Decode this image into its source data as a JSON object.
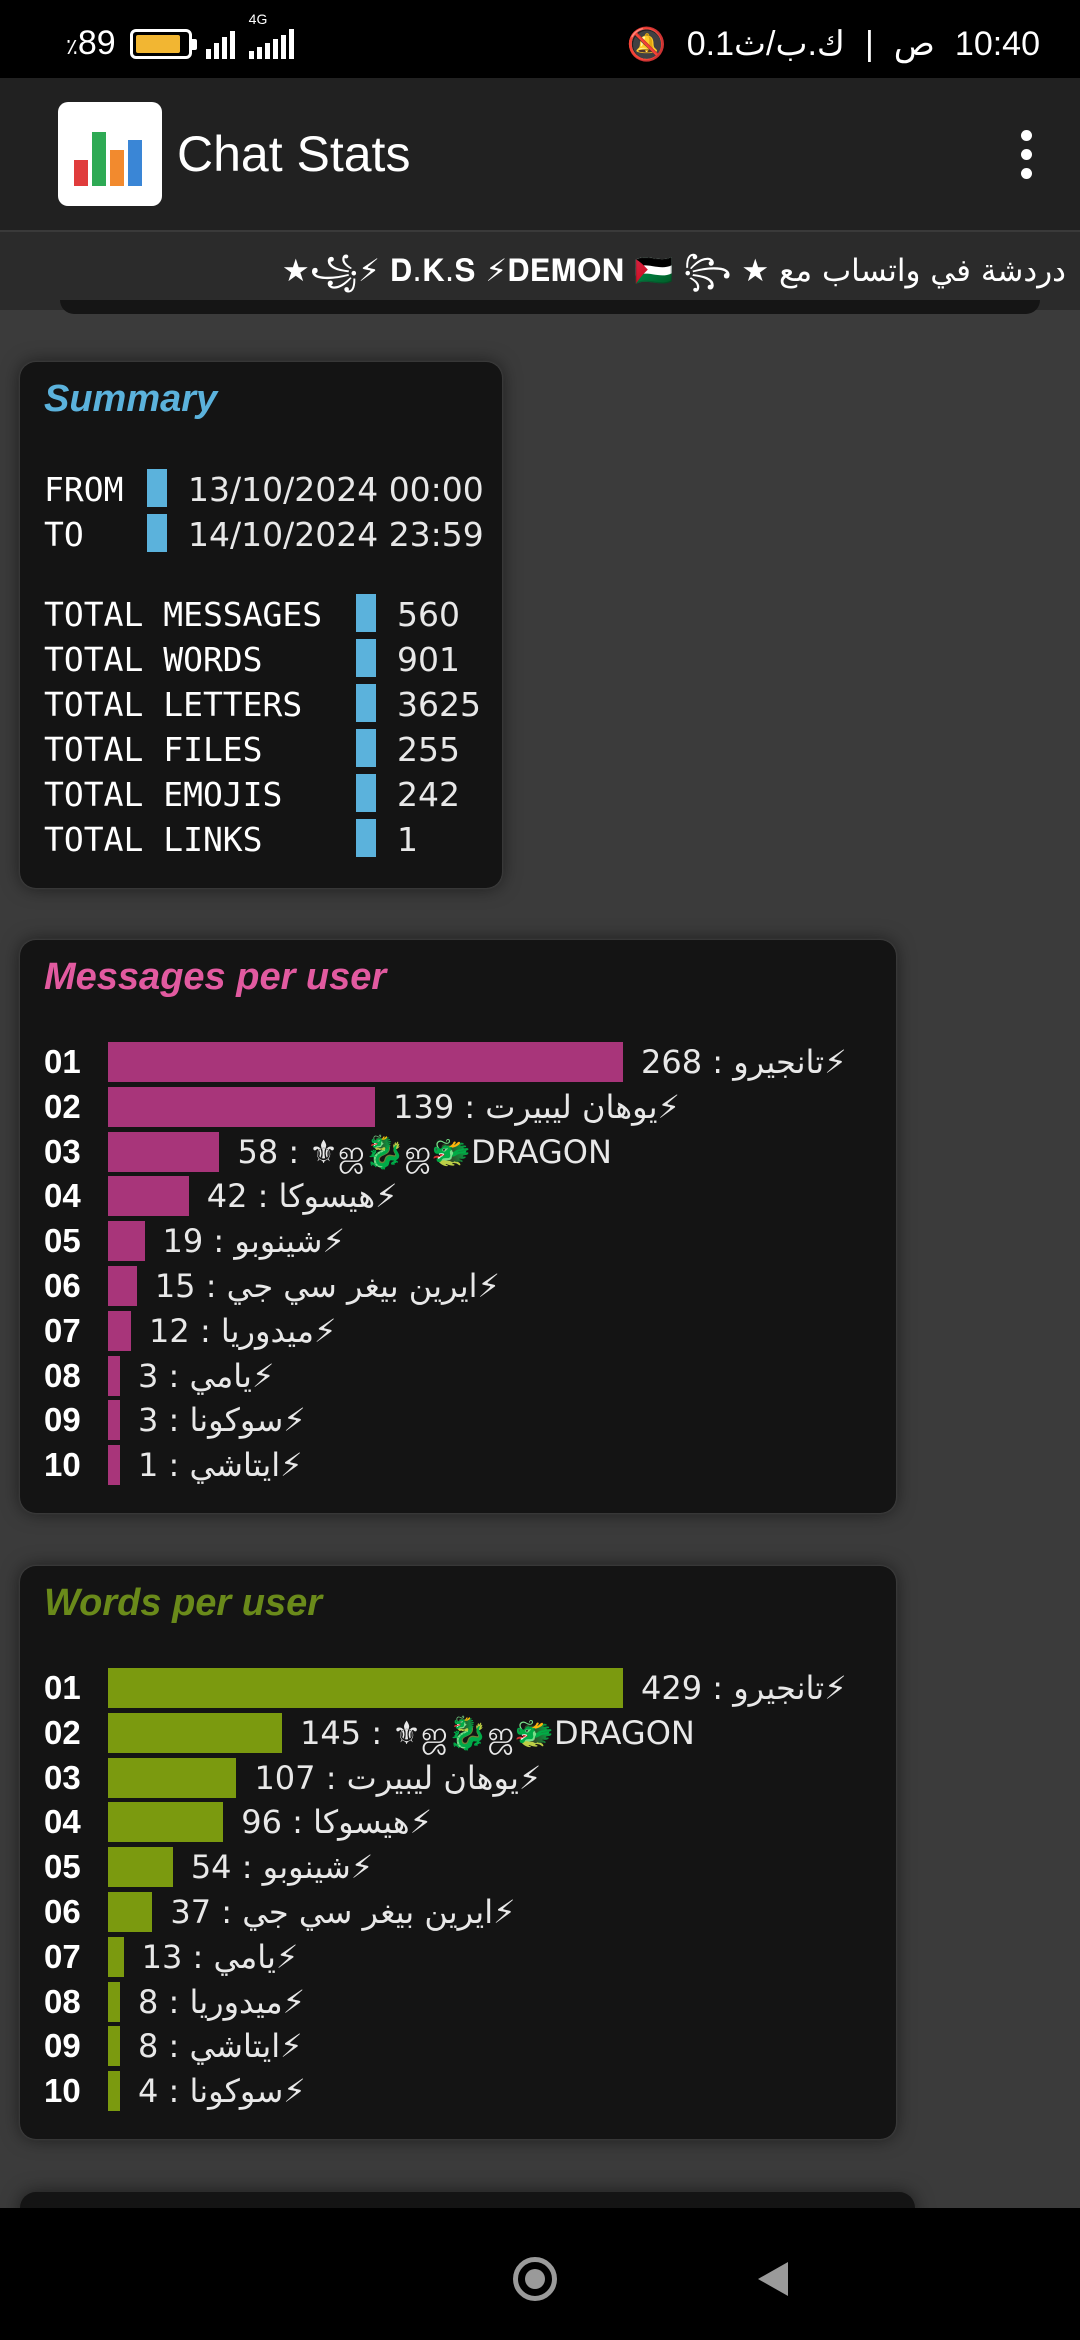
{
  "status_bar": {
    "battery": "89",
    "battery_pct_symbol": "٪",
    "battery_level": 0.89,
    "network": "4G",
    "speed": "0.1ك.ب/ث",
    "time": "10:40",
    "ampm": "ص"
  },
  "app": {
    "title": "Chat Stats",
    "icon": "bar-chart-icon",
    "menu_icon": "more-vert-icon"
  },
  "chat_name": "دردشة في واتساب مع ★ ꧁⚡ 𝐃.𝐊.𝐒 ⚡𝐃𝐄𝐌𝐎𝐍 🇵🇸 ꧂★",
  "summary": {
    "title": "Summary",
    "title_color": "#5bb2dc",
    "rows": [
      {
        "label": "FROM",
        "value": "13/10/2024 00:00"
      },
      {
        "label": "TO",
        "value": "14/10/2024 23:59"
      },
      {
        "label": "TOTAL MESSAGES",
        "value": "560"
      },
      {
        "label": "TOTAL WORDS",
        "value": "901"
      },
      {
        "label": "TOTAL LETTERS",
        "value": "3625"
      },
      {
        "label": "TOTAL FILES",
        "value": "255"
      },
      {
        "label": "TOTAL EMOJIS",
        "value": "242"
      },
      {
        "label": "TOTAL LINKS",
        "value": "1"
      }
    ]
  },
  "messages_per_user": {
    "title": "Messages per user",
    "title_color": "#e25aa0",
    "bar_color": "#a8357a",
    "rows": [
      {
        "rank": "01",
        "label": "268 : تانجيرو⚡",
        "value": 268
      },
      {
        "rank": "02",
        "label": "139 : يوهان ليبيرت⚡",
        "value": 139
      },
      {
        "rank": "03",
        "label": "58 : ⚜ஜ🐉ஜ🐲DRAGON",
        "value": 58
      },
      {
        "rank": "04",
        "label": "42 : هيسوكا⚡",
        "value": 42
      },
      {
        "rank": "05",
        "label": "19 : شينوبو⚡",
        "value": 19
      },
      {
        "rank": "06",
        "label": "15 : ايرين بيغر سي جي⚡",
        "value": 15
      },
      {
        "rank": "07",
        "label": "12 : ميدوريا⚡",
        "value": 12
      },
      {
        "rank": "08",
        "label": "3 : يامي⚡",
        "value": 3
      },
      {
        "rank": "09",
        "label": "3 : سوكونا⚡",
        "value": 3
      },
      {
        "rank": "10",
        "label": "1 : ايتاشي⚡",
        "value": 1
      }
    ]
  },
  "words_per_user": {
    "title": "Words per user",
    "title_color": "#6a8a1a",
    "bar_color": "#7b9a0f",
    "rows": [
      {
        "rank": "01",
        "label": "429 : تانجيرو⚡",
        "value": 429
      },
      {
        "rank": "02",
        "label": "145 : ⚜ஜ🐉ஜ🐲DRAGON",
        "value": 145
      },
      {
        "rank": "03",
        "label": "107 : يوهان ليبيرت⚡",
        "value": 107
      },
      {
        "rank": "04",
        "label": "96 : هيسوكا⚡",
        "value": 96
      },
      {
        "rank": "05",
        "label": "54 : شينوبو⚡",
        "value": 54
      },
      {
        "rank": "06",
        "label": "37 : ايرين بيغر سي جي⚡",
        "value": 37
      },
      {
        "rank": "07",
        "label": "13 : يامي⚡",
        "value": 13
      },
      {
        "rank": "08",
        "label": "8 : ميدوريا⚡",
        "value": 8
      },
      {
        "rank": "09",
        "label": "8 : ايتاشي⚡",
        "value": 8
      },
      {
        "rank": "10",
        "label": "4 : سوكونا⚡",
        "value": 4
      }
    ]
  },
  "nav": {
    "home": "home-button",
    "back": "back-button"
  }
}
